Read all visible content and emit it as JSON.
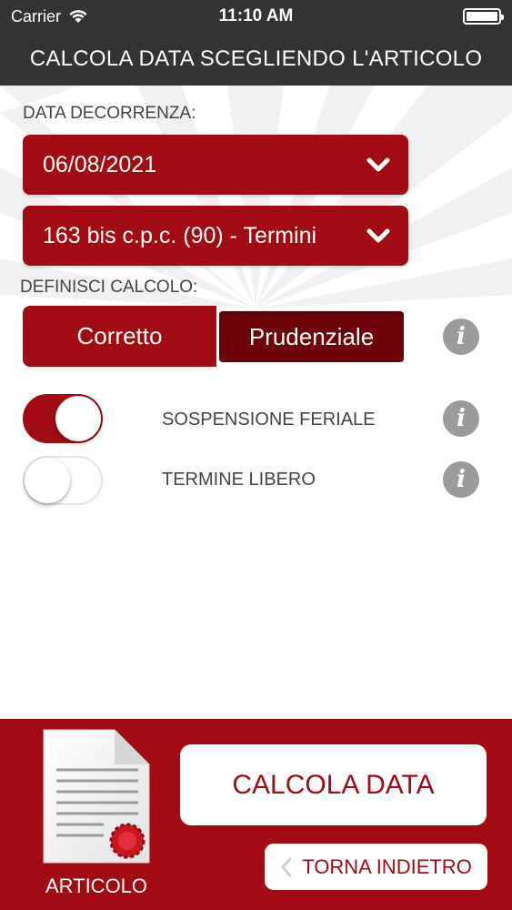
{
  "status_bar": {
    "carrier": "Carrier",
    "time": "11:10 AM"
  },
  "header": {
    "title": "CALCOLA DATA SCEGLIENDO L'ARTICOLO"
  },
  "form": {
    "date_label": "DATA DECORRENZA:",
    "date_value": "06/08/2021",
    "article_value": "163 bis c.p.c. (90) - Termini",
    "calc_label": "DEFINISCI CALCOLO:",
    "segments": [
      {
        "label": "Corretto",
        "selected": false
      },
      {
        "label": "Prudenziale",
        "selected": true
      }
    ],
    "toggles": [
      {
        "label": "SOSPENSIONE FERIALE",
        "on": true
      },
      {
        "label": "TERMINE LIBERO",
        "on": false
      }
    ],
    "info_glyph": "i"
  },
  "footer": {
    "doc_label": "ARTICOLO",
    "calc_button": "CALCOLA DATA",
    "back_button": "TORNA INDIETRO"
  },
  "colors": {
    "accent": "#a30b12",
    "accent_dark": "#6e0409",
    "header_bg": "#333333",
    "info_bg": "#9b9b9b"
  }
}
